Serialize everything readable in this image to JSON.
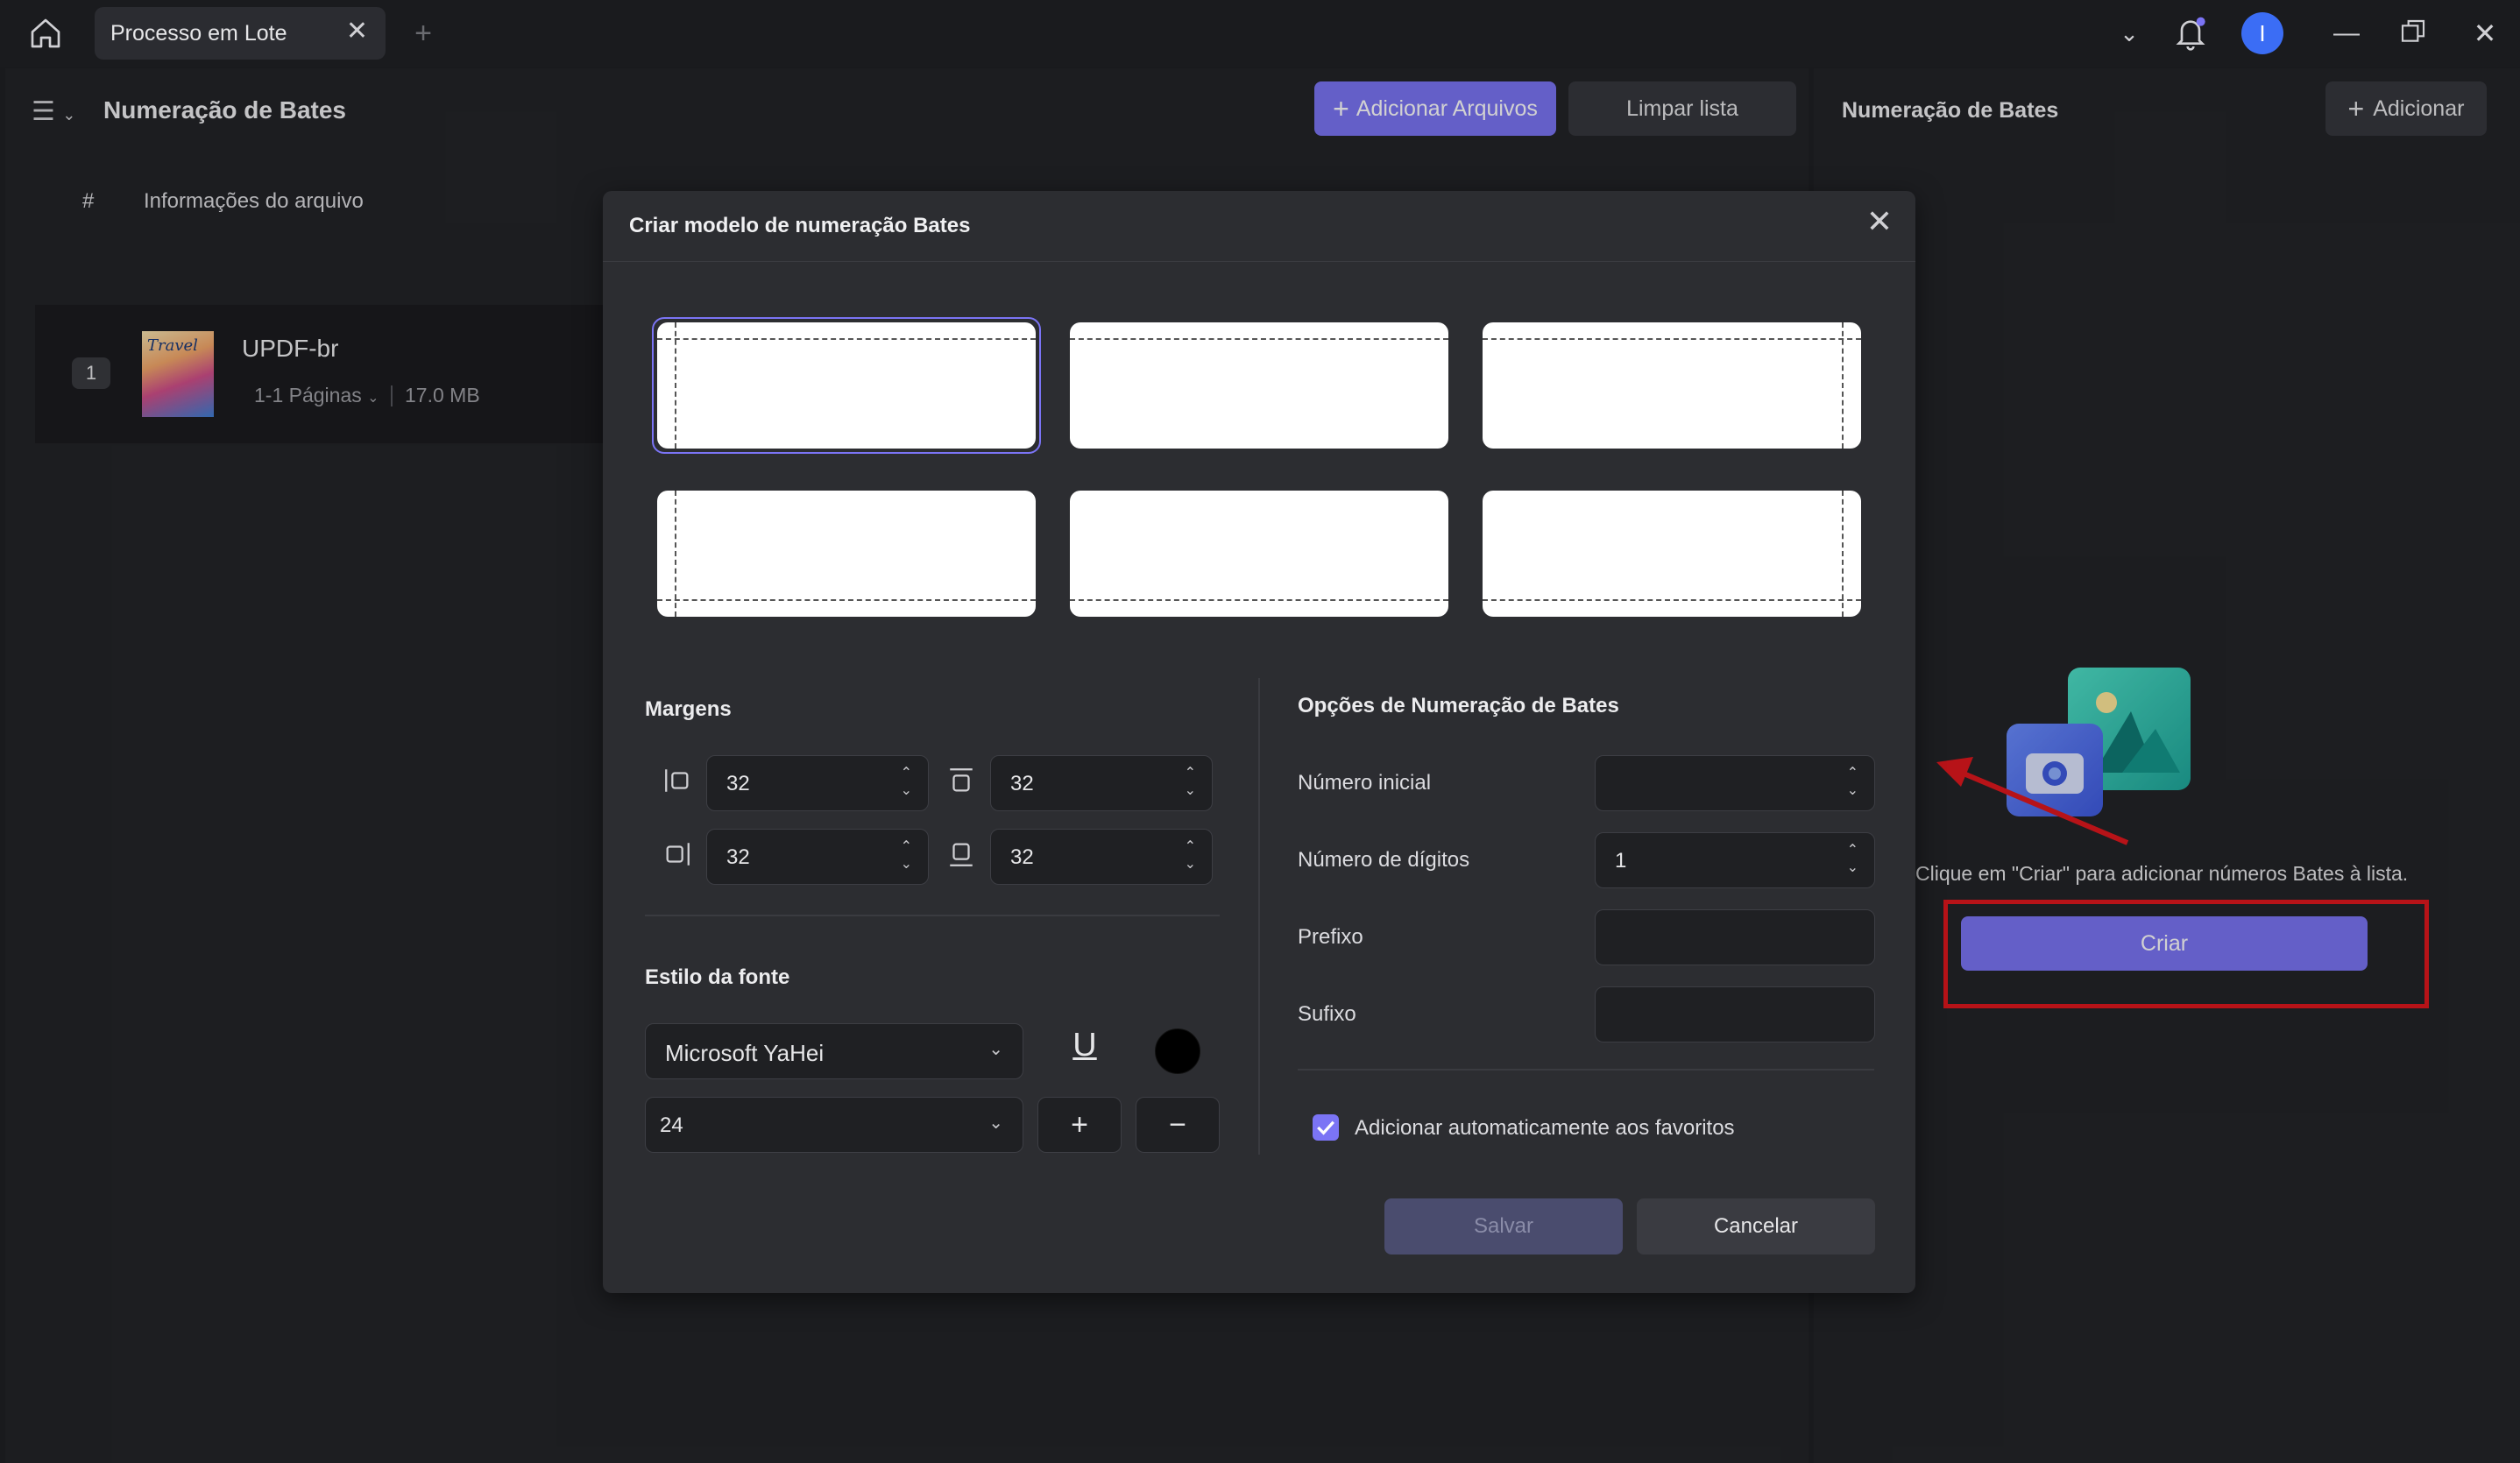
{
  "titlebar": {
    "tab_label": "Processo em Lote",
    "avatar_initial": "I",
    "colors": {
      "avatar": "#3b6df5"
    }
  },
  "header": {
    "title": "Numeração de Bates",
    "add_files_label": "Adicionar Arquivos",
    "clear_list_label": "Limpar lista"
  },
  "file_list": {
    "col_number": "#",
    "col_info": "Informações do arquivo",
    "items": [
      {
        "index": "1",
        "name": "UPDF-br",
        "pages": "1-1 Páginas",
        "size": "17.0 MB",
        "thumbnail_text": "Travel"
      }
    ]
  },
  "right_panel": {
    "title": "Numeração de Bates",
    "add_label": "Adicionar",
    "hint": "Clique em \"Criar\" para adicionar números Bates à lista.",
    "create_label": "Criar"
  },
  "modal": {
    "title": "Criar modelo de numeração Bates",
    "positions": [
      "top-left",
      "top-center",
      "top-right",
      "bottom-left",
      "bottom-center",
      "bottom-right"
    ],
    "selected_position": "top-left",
    "margins": {
      "label": "Margens",
      "left": "32",
      "top": "32",
      "right": "32",
      "bottom": "32"
    },
    "font": {
      "label": "Estilo da fonte",
      "family": "Microsoft YaHei",
      "size": "24",
      "underline_glyph": "U",
      "color": "#000000"
    },
    "options": {
      "label": "Opções de Numeração de Bates",
      "start_number_label": "Número inicial",
      "start_number_value": "",
      "digits_label": "Número de dígitos",
      "digits_value": "1",
      "prefix_label": "Prefixo",
      "prefix_value": "",
      "suffix_label": "Sufixo",
      "suffix_value": "",
      "auto_favorites_label": "Adicionar automaticamente aos favoritos",
      "auto_favorites_checked": true
    },
    "save_label": "Salvar",
    "cancel_label": "Cancelar"
  },
  "colors": {
    "accent": "#7b74f5",
    "annotation_red": "#e0181e"
  }
}
